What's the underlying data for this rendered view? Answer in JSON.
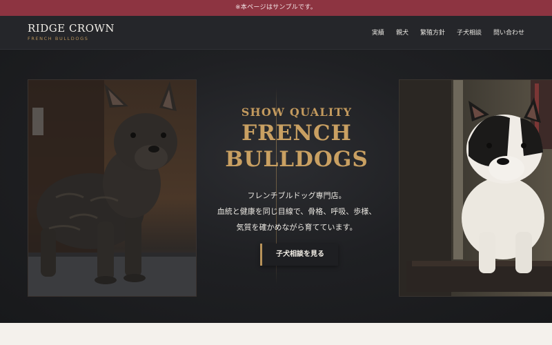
{
  "notice": "※本ページはサンプルです。",
  "brand": {
    "name": "RIDGE CROWN",
    "tagline": "FRENCH BULLDOGS"
  },
  "nav": {
    "items": [
      "実績",
      "親犬",
      "繁殖方針",
      "子犬相談",
      "問い合わせ"
    ]
  },
  "hero": {
    "eyebrow": "SHOW QUALITY",
    "headline_line1": "FRENCH",
    "headline_line2": "BULLDOGS",
    "copy_line1": "フレンチブルドッグ専門店。",
    "copy_line2": "血統と健康を同じ目線で、骨格、呼吸、歩様、",
    "copy_line3": "気質を確かめながら育てています。",
    "cta_label": "子犬相談を見る"
  },
  "colors": {
    "notice_bg": "#8d3441",
    "header_bg": "#25262a",
    "accent_gold": "#b8935a",
    "hero_bg": "#1f2023",
    "bottom_band": "#f4f1ec"
  }
}
